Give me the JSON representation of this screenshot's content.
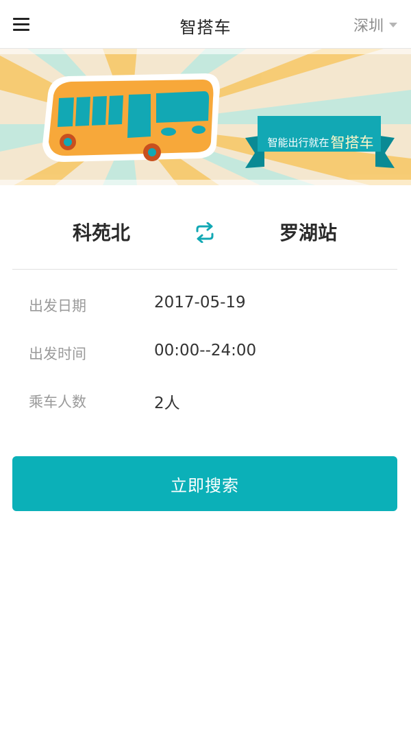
{
  "navbar": {
    "title": "智搭车",
    "city": "深圳"
  },
  "banner": {
    "slogan_small": "智能出行就在",
    "slogan_big": "智搭车"
  },
  "route": {
    "from": "科苑北",
    "to": "罗湖站"
  },
  "form": {
    "date_label": "出发日期",
    "date_value": "2017-05-19",
    "time_label": "出发时间",
    "time_value": "00:00--24:00",
    "people_label": "乘车人数",
    "people_value": "2人"
  },
  "search_button": {
    "label": "立即搜索"
  },
  "colors": {
    "accent": "#0bb0b8",
    "banner_bg": "#f4e7cf",
    "bus_orange": "#f7a83a",
    "bus_teal": "#12a8b4"
  },
  "icons": {
    "menu": "hamburger-menu-icon",
    "city_dropdown": "caret-down-icon",
    "swap": "swap-arrows-icon"
  }
}
